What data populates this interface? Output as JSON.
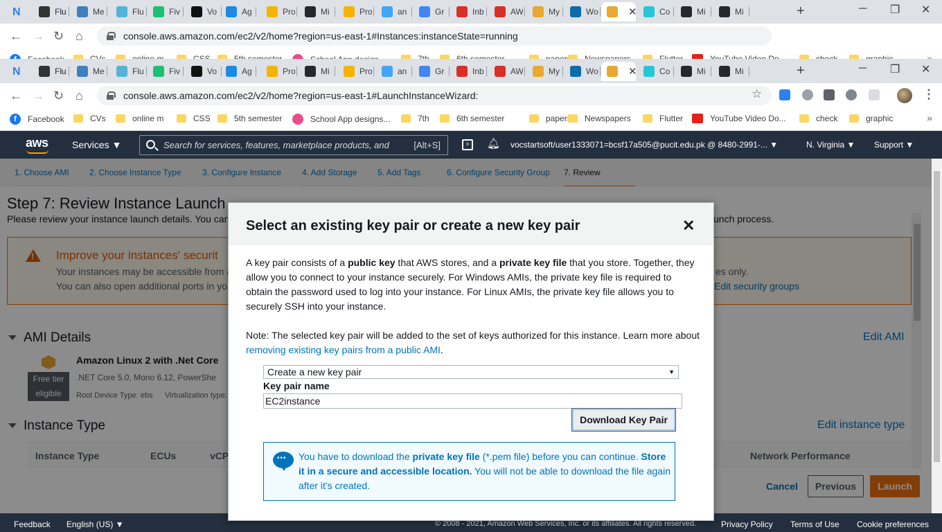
{
  "browser": {
    "tabs": [
      "Flu",
      "Flu",
      "Me",
      "Flu",
      "Fiv",
      "Vo",
      "Ag",
      "Pro",
      "Mi",
      "Pro",
      "an",
      "Gr",
      "Inb",
      "AW",
      "My",
      "Wo",
      "",
      "Co",
      "Mi",
      "Mi"
    ],
    "url_back": "console.aws.amazon.com/ec2/v2/home?region=us-east-1#Instances:instanceState=running",
    "url": "console.aws.amazon.com/ec2/v2/home?region=us-east-1#LaunchInstanceWizard:",
    "bookmarks": [
      "Facebook",
      "CVs",
      "online m",
      "CSS",
      "5th semester",
      "School App designs...",
      "7th",
      "6th semester",
      "papers",
      "Newspapers",
      "Flutter",
      "YouTube Video Do...",
      "check",
      "graphic"
    ],
    "bookmarks_back": [
      "Facebook",
      "CVs",
      "online m",
      "CSS",
      "5th semester",
      "School App desigs",
      "7th",
      "6th semester",
      "papers",
      "Newspapers",
      "Flutter",
      "YouTube Video Do",
      "check",
      "graphic"
    ]
  },
  "aws": {
    "logo": "aws",
    "services": "Services ▼",
    "search_placeholder": "Search for services, features, marketplace products, and",
    "search_kbd": "[Alt+S]",
    "account": "vocstartsoft/user1333071=bcsf17a505@pucit.edu.pk @ 8480-2991-... ▼",
    "region": "N. Virginia ▼",
    "support": "Support ▼"
  },
  "wizard": {
    "steps": [
      "1. Choose AMI",
      "2. Choose Instance Type",
      "3. Configure Instance",
      "4. Add Storage",
      "5. Add Tags",
      "6. Configure Security Group",
      "7. Review"
    ]
  },
  "page": {
    "title": "Step 7: Review Instance Launch",
    "subtitle_left": "Please review your instance launch details. You can",
    "subtitle_right": "unch process.",
    "warning_title": "Improve your instances' securit",
    "warning_line1": "Your instances may be accessible from a",
    "warning_line1_right": "es only.",
    "warning_line2": "You can also open additional ports in yo",
    "warning_link": "Edit security groups",
    "ami_section": "AMI Details",
    "ami_edit": "Edit AMI",
    "ami_title": "Amazon Linux 2 with .Net Core",
    "ami_desc": ".NET Core 5.0, Mono 6.12, PowerShe",
    "free_tier_1": "Free tier",
    "free_tier_2": "eligible",
    "root_device": "Root Device Type: ebs",
    "virt": "Virtualization type:",
    "instance_section": "Instance Type",
    "instance_edit": "Edit instance type",
    "table_headers": [
      "Instance Type",
      "ECUs",
      "vCP",
      "Network Performance"
    ],
    "cancel": "Cancel",
    "previous": "Previous",
    "launch": "Launch"
  },
  "footer": {
    "feedback": "Feedback",
    "language": "English (US) ▼",
    "copyright": "© 2008 - 2021, Amazon Web Services, Inc. or its affiliates. All rights reserved.",
    "privacy": "Privacy Policy",
    "terms": "Terms of Use",
    "cookies": "Cookie preferences"
  },
  "modal": {
    "title": "Select an existing key pair or create a new key pair",
    "close": "✕",
    "p1_a": "A key pair consists of a ",
    "p1_b": "public key",
    "p1_c": " that AWS stores, and a ",
    "p1_d": "private key file",
    "p1_e": " that you store. Together, they allow you to connect to your instance securely. For Windows AMIs, the private key file is required to obtain the password used to log into your instance. For Linux AMIs, the private key file allows you to securely SSH into your instance.",
    "p2_a": "Note: The selected key pair will be added to the set of keys authorized for this instance. Learn more about ",
    "p2_link": "removing existing key pairs from a public AMI",
    "p2_b": ".",
    "select_value": "Create a new key pair",
    "key_label": "Key pair name",
    "key_value": "EC2instance",
    "download": "Download Key Pair",
    "info_a": "You have to download the ",
    "info_b": "private key file",
    "info_c": " (*.pem file) before you can continue. ",
    "info_d": "Store it in a secure and accessible location.",
    "info_e": " You will not be able to download the file again after it's created."
  }
}
